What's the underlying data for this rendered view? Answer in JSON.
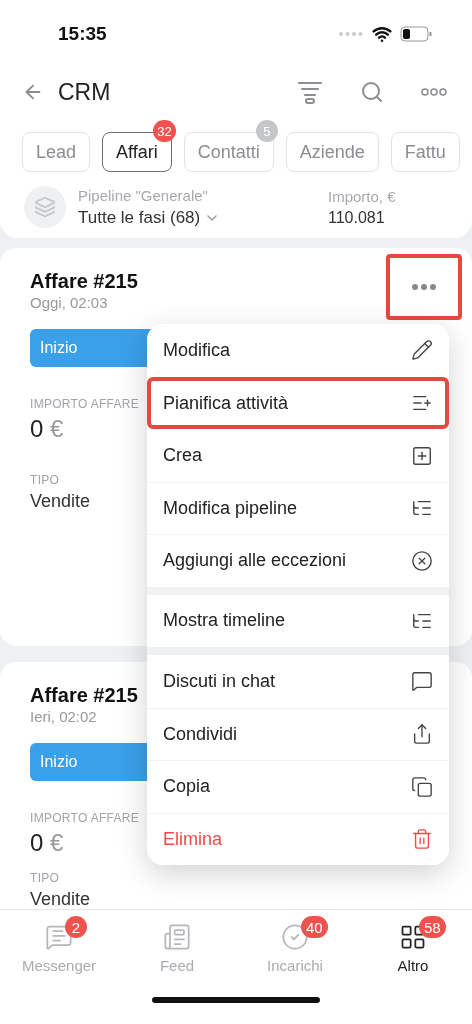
{
  "status_bar": {
    "time": "15:35"
  },
  "header": {
    "title": "CRM"
  },
  "tabs": [
    {
      "label": "Lead",
      "selected": false
    },
    {
      "label": "Affari",
      "selected": true,
      "badge": {
        "text": "32",
        "color": "#f0524f"
      }
    },
    {
      "label": "Contatti",
      "selected": false,
      "badge": {
        "text": "5",
        "color": "#c4c6c9"
      }
    },
    {
      "label": "Aziende",
      "selected": false
    },
    {
      "label": "Fattu",
      "selected": false
    }
  ],
  "pipeline": {
    "label": "Pipeline \"Generale\"",
    "value": "Tutte le fasi (68)",
    "amount_label": "Importo, €",
    "amount": "110.081"
  },
  "cards": [
    {
      "title": "Affare #215",
      "date": "Oggi, 02:03",
      "stage": "Inizio",
      "amount_label": "IMPORTO AFFARE",
      "amount": "0",
      "currency": "€",
      "type_label": "TIPO",
      "type": "Vendite",
      "menu_highlighted": true
    },
    {
      "title": "Affare #215",
      "date": "Ieri, 02:02",
      "stage": "Inizio",
      "amount_label": "IMPORTO AFFARE",
      "amount": "0",
      "currency": "€",
      "type_label": "TIPO",
      "type": "Vendite",
      "menu_highlighted": false
    }
  ],
  "menu": {
    "groups": [
      [
        {
          "label": "Modifica",
          "highlighted": false,
          "kind": "normal"
        },
        {
          "label": "Pianifica attività",
          "highlighted": true,
          "kind": "normal"
        },
        {
          "label": "Crea",
          "highlighted": false,
          "kind": "normal"
        },
        {
          "label": "Modifica pipeline",
          "highlighted": false,
          "kind": "normal"
        },
        {
          "label": "Aggiungi alle eccezioni",
          "highlighted": false,
          "kind": "normal"
        }
      ],
      [
        {
          "label": "Mostra timeline",
          "highlighted": false,
          "kind": "normal"
        }
      ],
      [
        {
          "label": "Discuti in chat",
          "highlighted": false,
          "kind": "normal"
        },
        {
          "label": "Condividi",
          "highlighted": false,
          "kind": "normal"
        },
        {
          "label": "Copia",
          "highlighted": false,
          "kind": "normal"
        },
        {
          "label": "Elimina",
          "highlighted": false,
          "kind": "danger"
        }
      ]
    ]
  },
  "bottom_tabs": [
    {
      "label": "Messenger",
      "selected": false,
      "badge": "2"
    },
    {
      "label": "Feed",
      "selected": false
    },
    {
      "label": "Incarichi",
      "selected": false,
      "badge": "40"
    },
    {
      "label": "Altro",
      "selected": true,
      "badge": "58"
    }
  ]
}
